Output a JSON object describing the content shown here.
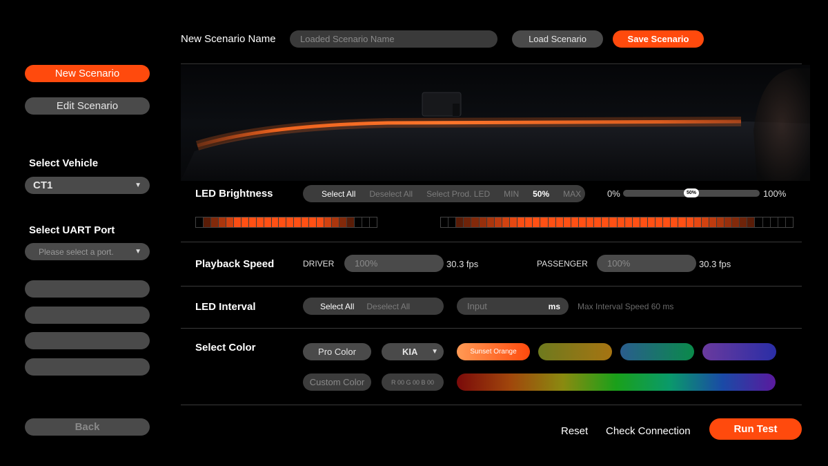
{
  "header": {
    "scenario_name_label": "New Scenario Name",
    "scenario_name_placeholder": "Loaded Scenario Name",
    "load_button": "Load Scenario",
    "save_button": "Save Scenario"
  },
  "sidebar": {
    "new_scenario": "New Scenario",
    "edit_scenario": "Edit Scenario",
    "select_vehicle_label": "Select Vehicle",
    "vehicle_value": "CT1",
    "select_uart_label": "Select UART Port",
    "uart_placeholder": "Please select a port.",
    "back": "Back"
  },
  "brightness": {
    "label": "LED Brightness",
    "options": [
      "Select All",
      "Deselect All",
      "Select Prod. LED",
      "MIN",
      "50%",
      "MAX"
    ],
    "slider_min": "0%",
    "slider_value": "50%",
    "slider_level": 0.5,
    "slider_max": "100%"
  },
  "playback": {
    "label": "Playback Speed",
    "driver_label": "DRIVER",
    "driver_value": "100%",
    "driver_fps": "30.3 fps",
    "passenger_label": "PASSENGER",
    "passenger_value": "100%",
    "passenger_fps": "30.3 fps"
  },
  "interval": {
    "label": "LED Interval",
    "select_all": "Select All",
    "deselect_all": "Deselect All",
    "input_placeholder": "Input",
    "unit": "ms",
    "hint": "Max Interval Speed 60 ms"
  },
  "color": {
    "label": "Select Color",
    "pro_color": "Pro Color",
    "brand_value": "KIA",
    "custom_color": "Custom Color",
    "rgb_value": "R 00 G 00 B 00",
    "swatch_1": "Sunset Orange"
  },
  "footer": {
    "reset": "Reset",
    "check_connection": "Check Connection",
    "run_test": "Run Test"
  },
  "colors": {
    "accent": "#ff4a0d",
    "button_grey": "#4a4a4a",
    "background": "#000000"
  }
}
